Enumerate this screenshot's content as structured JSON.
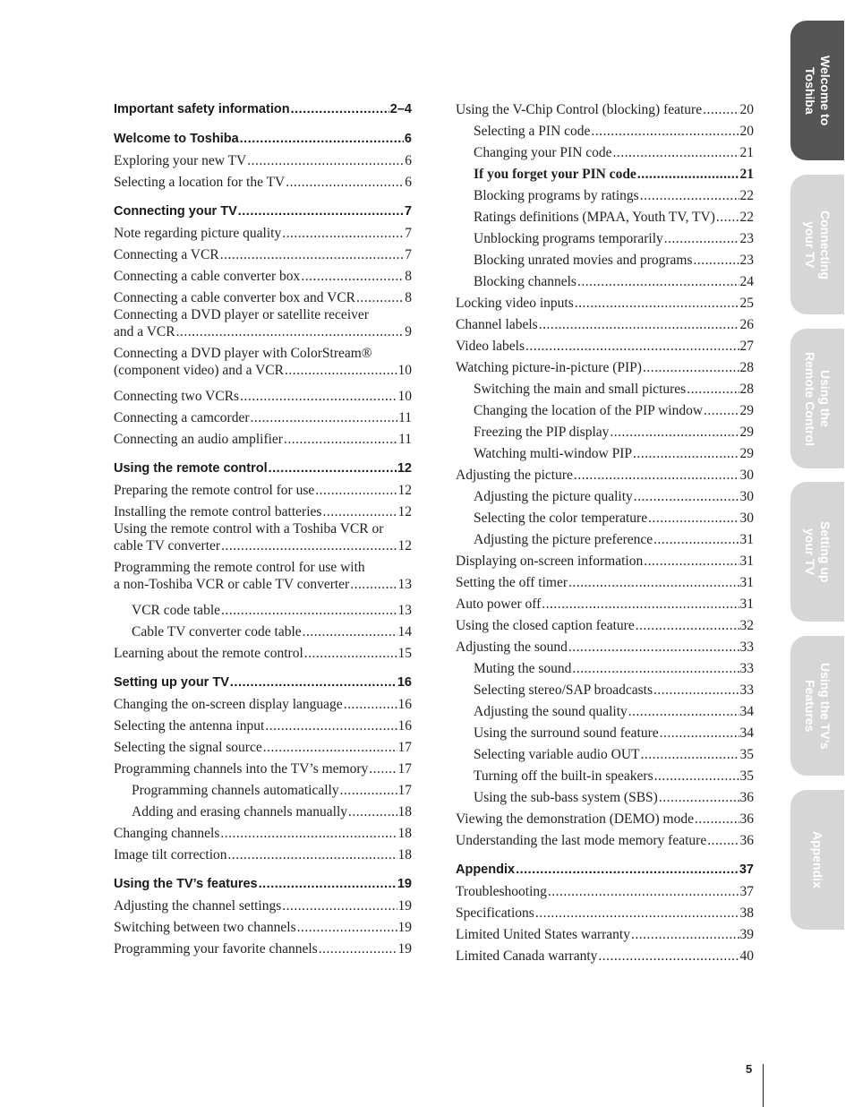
{
  "toc_left": [
    {
      "type": "head",
      "text": "Important safety information",
      "page": "2–4"
    },
    {
      "type": "head",
      "text": "Welcome to Toshiba",
      "page": "6"
    },
    {
      "type": "item",
      "text": "Exploring your new TV",
      "page": "6"
    },
    {
      "type": "item",
      "text": "Selecting a location for the TV",
      "page": "6"
    },
    {
      "type": "head",
      "text": "Connecting your TV",
      "page": "7"
    },
    {
      "type": "item",
      "text": "Note regarding picture quality",
      "page": "7"
    },
    {
      "type": "item",
      "text": "Connecting a VCR",
      "page": "7"
    },
    {
      "type": "item",
      "text": "Connecting a cable converter box",
      "page": "8"
    },
    {
      "type": "item",
      "text": "Connecting a cable converter box and VCR",
      "page": "8"
    },
    {
      "type": "two",
      "line1": "Connecting a DVD player or satellite receiver",
      "text": "and a VCR",
      "page": "9"
    },
    {
      "type": "two",
      "line1": "Connecting a DVD player with ColorStream®",
      "text": "(component video) and a VCR",
      "page": "10"
    },
    {
      "type": "item",
      "text": "Connecting two VCRs",
      "page": "10"
    },
    {
      "type": "item",
      "text": "Connecting a camcorder",
      "page": "11"
    },
    {
      "type": "item",
      "text": "Connecting an audio amplifier",
      "page": "11"
    },
    {
      "type": "head",
      "text": "Using the remote control",
      "page": "12"
    },
    {
      "type": "item",
      "text": "Preparing the remote control for use",
      "page": "12"
    },
    {
      "type": "item",
      "text": "Installing the remote control batteries",
      "page": "12"
    },
    {
      "type": "two",
      "line1": "Using the remote control with a Toshiba VCR or",
      "text": "cable TV converter",
      "page": "12"
    },
    {
      "type": "two",
      "line1": "Programming the remote control for use with",
      "text": "a non-Toshiba VCR or cable TV converter",
      "page": "13"
    },
    {
      "type": "sub",
      "text": "VCR code table",
      "page": "13"
    },
    {
      "type": "sub",
      "text": "Cable TV converter code table",
      "page": "14"
    },
    {
      "type": "item",
      "text": "Learning about the remote control",
      "page": "15"
    },
    {
      "type": "head",
      "text": "Setting up your TV",
      "page": "16"
    },
    {
      "type": "item",
      "text": "Changing the on-screen display language",
      "page": "16"
    },
    {
      "type": "item",
      "text": "Selecting the antenna input",
      "page": "16"
    },
    {
      "type": "item",
      "text": "Selecting the signal source",
      "page": "17"
    },
    {
      "type": "item",
      "text": "Programming channels into the TV’s memory",
      "page": "17"
    },
    {
      "type": "sub",
      "text": "Programming channels automatically",
      "page": "17"
    },
    {
      "type": "sub",
      "text": "Adding and erasing channels manually",
      "page": "18"
    },
    {
      "type": "item",
      "text": "Changing channels",
      "page": "18"
    },
    {
      "type": "item",
      "text": "Image tilt correction",
      "page": "18"
    },
    {
      "type": "head",
      "text": "Using the TV’s features",
      "page": "19"
    },
    {
      "type": "item",
      "text": "Adjusting the channel settings",
      "page": "19"
    },
    {
      "type": "item",
      "text": "Switching between two channels",
      "page": "19"
    },
    {
      "type": "item",
      "text": "Programming your favorite channels",
      "page": "19"
    }
  ],
  "toc_right": [
    {
      "type": "item",
      "text": "Using the V-Chip Control (blocking) feature",
      "page": "20"
    },
    {
      "type": "sub",
      "text": "Selecting a PIN code",
      "page": "20"
    },
    {
      "type": "sub",
      "text": "Changing your PIN code",
      "page": "21"
    },
    {
      "type": "subbold",
      "text": "If you forget your PIN code",
      "page": "21"
    },
    {
      "type": "sub",
      "text": "Blocking programs by ratings",
      "page": "22"
    },
    {
      "type": "sub",
      "text": "Ratings definitions (MPAA, Youth TV, TV)",
      "page": "22"
    },
    {
      "type": "sub",
      "text": "Unblocking programs temporarily",
      "page": "23"
    },
    {
      "type": "sub",
      "text": "Blocking unrated movies and programs",
      "page": "23"
    },
    {
      "type": "sub",
      "text": "Blocking channels",
      "page": "24"
    },
    {
      "type": "item",
      "text": "Locking video inputs",
      "page": "25"
    },
    {
      "type": "item",
      "text": "Channel labels",
      "page": "26"
    },
    {
      "type": "item",
      "text": "Video labels",
      "page": "27"
    },
    {
      "type": "item",
      "text": "Watching picture-in-picture (PIP)",
      "page": "28"
    },
    {
      "type": "sub",
      "text": "Switching the main and small pictures",
      "page": "28"
    },
    {
      "type": "sub",
      "text": "Changing the location of the PIP window",
      "page": "29"
    },
    {
      "type": "sub",
      "text": "Freezing the PIP display",
      "page": "29"
    },
    {
      "type": "sub",
      "text": "Watching multi-window PIP",
      "page": "29"
    },
    {
      "type": "item",
      "text": "Adjusting the picture",
      "page": "30"
    },
    {
      "type": "sub",
      "text": "Adjusting the picture quality",
      "page": "30"
    },
    {
      "type": "sub",
      "text": "Selecting the color temperature",
      "page": "30"
    },
    {
      "type": "sub",
      "text": "Adjusting the picture preference",
      "page": "31"
    },
    {
      "type": "item",
      "text": "Displaying on-screen information",
      "page": "31"
    },
    {
      "type": "item",
      "text": "Setting the off timer",
      "page": "31"
    },
    {
      "type": "item",
      "text": "Auto power off",
      "page": "31"
    },
    {
      "type": "item",
      "text": "Using the closed caption feature",
      "page": "32"
    },
    {
      "type": "item",
      "text": "Adjusting the sound",
      "page": "33"
    },
    {
      "type": "sub",
      "text": "Muting the sound",
      "page": "33"
    },
    {
      "type": "sub",
      "text": "Selecting stereo/SAP broadcasts",
      "page": "33"
    },
    {
      "type": "sub",
      "text": "Adjusting the sound quality",
      "page": "34"
    },
    {
      "type": "sub",
      "text": "Using the surround sound feature",
      "page": "34"
    },
    {
      "type": "sub",
      "text": "Selecting variable audio OUT",
      "page": "35"
    },
    {
      "type": "sub",
      "text": "Turning off the built-in speakers",
      "page": "35"
    },
    {
      "type": "sub",
      "text": "Using the sub-bass system (SBS)",
      "page": "36"
    },
    {
      "type": "item",
      "text": "Viewing the demonstration (DEMO) mode",
      "page": "36"
    },
    {
      "type": "item",
      "text": "Understanding the last mode memory feature",
      "page": "36"
    },
    {
      "type": "head",
      "text": "Appendix",
      "page": "37"
    },
    {
      "type": "item",
      "text": "Troubleshooting",
      "page": "37"
    },
    {
      "type": "item",
      "text": "Specifications",
      "page": "38"
    },
    {
      "type": "item",
      "text": "Limited United States warranty",
      "page": "39"
    },
    {
      "type": "item",
      "text": "Limited Canada warranty",
      "page": "40"
    }
  ],
  "tabs": [
    {
      "label": "Welcome to\nToshiba",
      "active": true
    },
    {
      "label": "Connecting\nyour TV",
      "active": false
    },
    {
      "label": "Using the\nRemote Control",
      "active": false
    },
    {
      "label": "Setting up\nyour TV",
      "active": false
    },
    {
      "label": "Using the TV’s\nFeatures",
      "active": false
    },
    {
      "label": "Appendix",
      "active": false
    }
  ],
  "page_number": "5"
}
